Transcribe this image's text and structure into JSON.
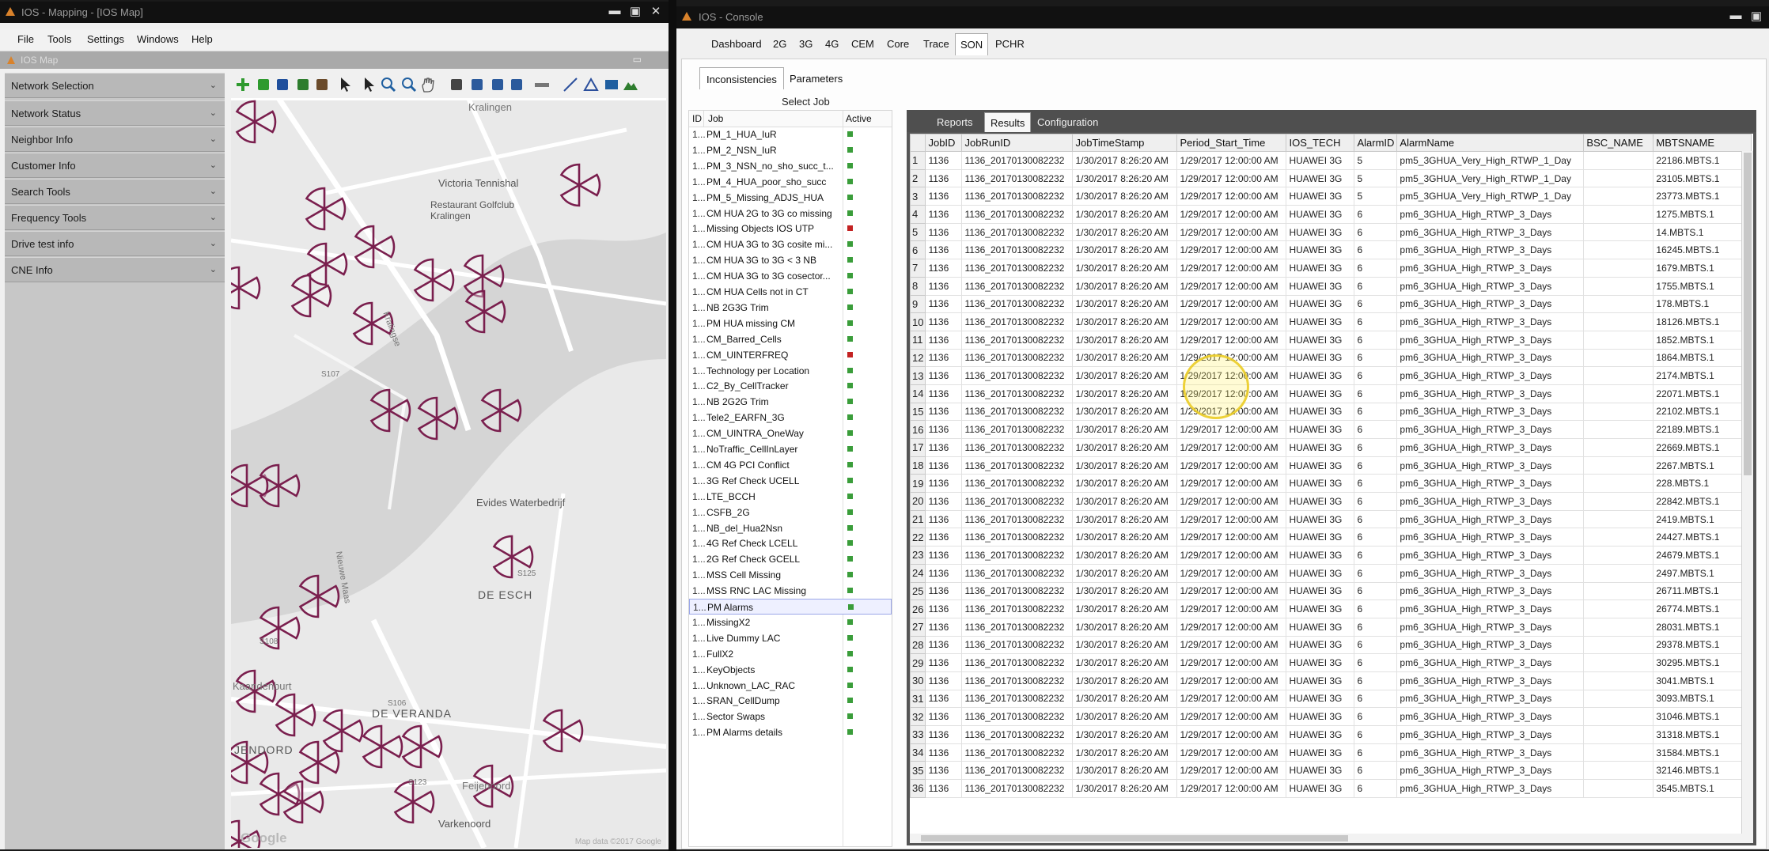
{
  "left_window": {
    "title": "IOS - Mapping - [IOS Map]",
    "menu": [
      "File",
      "Tools",
      "Settings",
      "Windows",
      "Help"
    ],
    "map_bar_title": "IOS Map",
    "panel_items": [
      "Network Selection",
      "Network Status",
      "Neighbor Info",
      "Customer Info",
      "Search Tools",
      "Frequency Tools",
      "Drive test info",
      "CNE Info"
    ],
    "toolbar_icons": [
      "add-icon",
      "add-layer-icon",
      "save-icon",
      "layers-icon",
      "theme-icon",
      "pointer-icon",
      "select-text-icon",
      "zoom-in-icon",
      "zoom-out-icon",
      "pan-hand-icon",
      "select-icon",
      "select-area-icon",
      "select-polygon-icon",
      "select-shape-icon",
      "ruler-icon",
      "line-icon",
      "polygon-icon",
      "rectangle-icon",
      "terrain-icon"
    ],
    "map": {
      "labels": [
        "Kralingen",
        "Victoria Tennishal",
        "Restaurant Golfclub Kralingen",
        "Kralingse",
        "Evides Waterbedrijf",
        "DE ESCH",
        "DE VERANDA",
        "Kaandenburt",
        "JENDORD",
        "Varkenoord",
        "Feijenoord",
        "Nieuwe Maas",
        "S107",
        "S106",
        "S123",
        "S108",
        "S125"
      ],
      "google": "Google",
      "attribution": "Map data ©2017 Google"
    }
  },
  "right_window": {
    "title": "IOS - Console",
    "tabs": [
      "Dashboard",
      "2G",
      "3G",
      "4G",
      "CEM",
      "Core",
      "Trace",
      "SON",
      "PCHR"
    ],
    "active_tab": "SON",
    "sub_tabs": [
      "Inconsistencies",
      "Parameters"
    ],
    "select_job_label": "Select Job",
    "job_list": {
      "headers": {
        "id": "ID",
        "job": "Job",
        "active": "Active"
      },
      "selected": "PM Alarms",
      "jobs": [
        {
          "id": "1...",
          "name": "PM_1_HUA_IuR",
          "status": "green"
        },
        {
          "id": "1...",
          "name": "PM_2_NSN_IuR",
          "status": "green"
        },
        {
          "id": "1...",
          "name": "PM_3_NSN_no_sho_succ_t...",
          "status": "green"
        },
        {
          "id": "1...",
          "name": "PM_4_HUA_poor_sho_succ",
          "status": "green"
        },
        {
          "id": "1...",
          "name": "PM_5_Missing_ADJS_HUA",
          "status": "green"
        },
        {
          "id": "1...",
          "name": "CM HUA 2G to 3G co missing",
          "status": "green"
        },
        {
          "id": "1...",
          "name": "Missing Objects IOS UTP",
          "status": "red"
        },
        {
          "id": "1...",
          "name": "CM HUA 3G to 3G cosite mi...",
          "status": "green"
        },
        {
          "id": "1...",
          "name": "CM HUA 3G to 3G < 3 NB",
          "status": "green"
        },
        {
          "id": "1...",
          "name": "CM HUA 3G to 3G cosector...",
          "status": "green"
        },
        {
          "id": "1...",
          "name": "CM HUA Cells not in CT",
          "status": "green"
        },
        {
          "id": "1...",
          "name": "NB 2G3G Trim",
          "status": "green"
        },
        {
          "id": "1...",
          "name": "PM HUA missing CM",
          "status": "green"
        },
        {
          "id": "1...",
          "name": "CM_Barred_Cells",
          "status": "green"
        },
        {
          "id": "1...",
          "name": "CM_UINTERFREQ",
          "status": "red"
        },
        {
          "id": "1...",
          "name": "Technology per Location",
          "status": "green"
        },
        {
          "id": "1...",
          "name": "C2_By_CellTracker",
          "status": "green"
        },
        {
          "id": "1...",
          "name": "NB 2G2G Trim",
          "status": "green"
        },
        {
          "id": "1...",
          "name": "Tele2_EARFN_3G",
          "status": "green"
        },
        {
          "id": "1...",
          "name": "CM_UINTRA_OneWay",
          "status": "green"
        },
        {
          "id": "1...",
          "name": "NoTraffic_CellInLayer",
          "status": "green"
        },
        {
          "id": "1...",
          "name": "CM 4G PCI Conflict",
          "status": "green"
        },
        {
          "id": "1...",
          "name": "3G Ref Check UCELL",
          "status": "green"
        },
        {
          "id": "1...",
          "name": "LTE_BCCH",
          "status": "green"
        },
        {
          "id": "1...",
          "name": "CSFB_2G",
          "status": "green"
        },
        {
          "id": "1...",
          "name": "NB_del_Hua2Nsn",
          "status": "green"
        },
        {
          "id": "1...",
          "name": "4G Ref Check LCELL",
          "status": "green"
        },
        {
          "id": "1...",
          "name": "2G Ref Check GCELL",
          "status": "green"
        },
        {
          "id": "1...",
          "name": "MSS Cell Missing",
          "status": "green"
        },
        {
          "id": "1...",
          "name": "MSS RNC LAC Missing",
          "status": "green"
        },
        {
          "id": "1...",
          "name": "PM Alarms",
          "status": "green"
        },
        {
          "id": "1...",
          "name": "MissingX2",
          "status": "green"
        },
        {
          "id": "1...",
          "name": "Live Dummy LAC",
          "status": "green"
        },
        {
          "id": "1...",
          "name": "FullX2",
          "status": "green"
        },
        {
          "id": "1...",
          "name": "KeyObjects",
          "status": "green"
        },
        {
          "id": "1...",
          "name": "Unknown_LAC_RAC",
          "status": "green"
        },
        {
          "id": "1...",
          "name": "SRAN_CellDump",
          "status": "green"
        },
        {
          "id": "1...",
          "name": "Sector Swaps",
          "status": "green"
        },
        {
          "id": "1...",
          "name": "PM Alarms details",
          "status": "green"
        }
      ]
    },
    "result_tabs": [
      "Reports",
      "Results",
      "Configuration"
    ],
    "active_result_tab": "Results",
    "grid": {
      "columns": [
        "",
        "JobID",
        "JobRunID",
        "JobTimeStamp",
        "Period_Start_Time",
        "IOS_TECH",
        "AlarmID",
        "AlarmName",
        "BSC_NAME",
        "MBTSNAME"
      ],
      "rows": [
        [
          "1",
          "1136",
          "1136_20170130082232",
          "1/30/2017 8:26:20 AM",
          "1/29/2017 12:00:00 AM",
          "HUAWEI 3G",
          "5",
          "pm5_3GHUA_Very_High_RTWP_1_Day",
          "",
          "22186.MBTS.1"
        ],
        [
          "2",
          "1136",
          "1136_20170130082232",
          "1/30/2017 8:26:20 AM",
          "1/29/2017 12:00:00 AM",
          "HUAWEI 3G",
          "5",
          "pm5_3GHUA_Very_High_RTWP_1_Day",
          "",
          "23105.MBTS.1"
        ],
        [
          "3",
          "1136",
          "1136_20170130082232",
          "1/30/2017 8:26:20 AM",
          "1/29/2017 12:00:00 AM",
          "HUAWEI 3G",
          "5",
          "pm5_3GHUA_Very_High_RTWP_1_Day",
          "",
          "23773.MBTS.1"
        ],
        [
          "4",
          "1136",
          "1136_20170130082232",
          "1/30/2017 8:26:20 AM",
          "1/29/2017 12:00:00 AM",
          "HUAWEI 3G",
          "6",
          "pm6_3GHUA_High_RTWP_3_Days",
          "",
          "1275.MBTS.1"
        ],
        [
          "5",
          "1136",
          "1136_20170130082232",
          "1/30/2017 8:26:20 AM",
          "1/29/2017 12:00:00 AM",
          "HUAWEI 3G",
          "6",
          "pm6_3GHUA_High_RTWP_3_Days",
          "",
          "14.MBTS.1"
        ],
        [
          "6",
          "1136",
          "1136_20170130082232",
          "1/30/2017 8:26:20 AM",
          "1/29/2017 12:00:00 AM",
          "HUAWEI 3G",
          "6",
          "pm6_3GHUA_High_RTWP_3_Days",
          "",
          "16245.MBTS.1"
        ],
        [
          "7",
          "1136",
          "1136_20170130082232",
          "1/30/2017 8:26:20 AM",
          "1/29/2017 12:00:00 AM",
          "HUAWEI 3G",
          "6",
          "pm6_3GHUA_High_RTWP_3_Days",
          "",
          "1679.MBTS.1"
        ],
        [
          "8",
          "1136",
          "1136_20170130082232",
          "1/30/2017 8:26:20 AM",
          "1/29/2017 12:00:00 AM",
          "HUAWEI 3G",
          "6",
          "pm6_3GHUA_High_RTWP_3_Days",
          "",
          "1755.MBTS.1"
        ],
        [
          "9",
          "1136",
          "1136_20170130082232",
          "1/30/2017 8:26:20 AM",
          "1/29/2017 12:00:00 AM",
          "HUAWEI 3G",
          "6",
          "pm6_3GHUA_High_RTWP_3_Days",
          "",
          "178.MBTS.1"
        ],
        [
          "10",
          "1136",
          "1136_20170130082232",
          "1/30/2017 8:26:20 AM",
          "1/29/2017 12:00:00 AM",
          "HUAWEI 3G",
          "6",
          "pm6_3GHUA_High_RTWP_3_Days",
          "",
          "18126.MBTS.1"
        ],
        [
          "11",
          "1136",
          "1136_20170130082232",
          "1/30/2017 8:26:20 AM",
          "1/29/2017 12:00:00 AM",
          "HUAWEI 3G",
          "6",
          "pm6_3GHUA_High_RTWP_3_Days",
          "",
          "1852.MBTS.1"
        ],
        [
          "12",
          "1136",
          "1136_20170130082232",
          "1/30/2017 8:26:20 AM",
          "1/29/2017 12:00:00 AM",
          "HUAWEI 3G",
          "6",
          "pm6_3GHUA_High_RTWP_3_Days",
          "",
          "1864.MBTS.1"
        ],
        [
          "13",
          "1136",
          "1136_20170130082232",
          "1/30/2017 8:26:20 AM",
          "1/29/2017 12:00:00 AM",
          "HUAWEI 3G",
          "6",
          "pm6_3GHUA_High_RTWP_3_Days",
          "",
          "2174.MBTS.1"
        ],
        [
          "14",
          "1136",
          "1136_20170130082232",
          "1/30/2017 8:26:20 AM",
          "1/29/2017 12:00:00 AM",
          "HUAWEI 3G",
          "6",
          "pm6_3GHUA_High_RTWP_3_Days",
          "",
          "22071.MBTS.1"
        ],
        [
          "15",
          "1136",
          "1136_20170130082232",
          "1/30/2017 8:26:20 AM",
          "1/29/2017 12:00:00 AM",
          "HUAWEI 3G",
          "6",
          "pm6_3GHUA_High_RTWP_3_Days",
          "",
          "22102.MBTS.1"
        ],
        [
          "16",
          "1136",
          "1136_20170130082232",
          "1/30/2017 8:26:20 AM",
          "1/29/2017 12:00:00 AM",
          "HUAWEI 3G",
          "6",
          "pm6_3GHUA_High_RTWP_3_Days",
          "",
          "22189.MBTS.1"
        ],
        [
          "17",
          "1136",
          "1136_20170130082232",
          "1/30/2017 8:26:20 AM",
          "1/29/2017 12:00:00 AM",
          "HUAWEI 3G",
          "6",
          "pm6_3GHUA_High_RTWP_3_Days",
          "",
          "22669.MBTS.1"
        ],
        [
          "18",
          "1136",
          "1136_20170130082232",
          "1/30/2017 8:26:20 AM",
          "1/29/2017 12:00:00 AM",
          "HUAWEI 3G",
          "6",
          "pm6_3GHUA_High_RTWP_3_Days",
          "",
          "2267.MBTS.1"
        ],
        [
          "19",
          "1136",
          "1136_20170130082232",
          "1/30/2017 8:26:20 AM",
          "1/29/2017 12:00:00 AM",
          "HUAWEI 3G",
          "6",
          "pm6_3GHUA_High_RTWP_3_Days",
          "",
          "228.MBTS.1"
        ],
        [
          "20",
          "1136",
          "1136_20170130082232",
          "1/30/2017 8:26:20 AM",
          "1/29/2017 12:00:00 AM",
          "HUAWEI 3G",
          "6",
          "pm6_3GHUA_High_RTWP_3_Days",
          "",
          "22842.MBTS.1"
        ],
        [
          "21",
          "1136",
          "1136_20170130082232",
          "1/30/2017 8:26:20 AM",
          "1/29/2017 12:00:00 AM",
          "HUAWEI 3G",
          "6",
          "pm6_3GHUA_High_RTWP_3_Days",
          "",
          "2419.MBTS.1"
        ],
        [
          "22",
          "1136",
          "1136_20170130082232",
          "1/30/2017 8:26:20 AM",
          "1/29/2017 12:00:00 AM",
          "HUAWEI 3G",
          "6",
          "pm6_3GHUA_High_RTWP_3_Days",
          "",
          "24427.MBTS.1"
        ],
        [
          "23",
          "1136",
          "1136_20170130082232",
          "1/30/2017 8:26:20 AM",
          "1/29/2017 12:00:00 AM",
          "HUAWEI 3G",
          "6",
          "pm6_3GHUA_High_RTWP_3_Days",
          "",
          "24679.MBTS.1"
        ],
        [
          "24",
          "1136",
          "1136_20170130082232",
          "1/30/2017 8:26:20 AM",
          "1/29/2017 12:00:00 AM",
          "HUAWEI 3G",
          "6",
          "pm6_3GHUA_High_RTWP_3_Days",
          "",
          "2497.MBTS.1"
        ],
        [
          "25",
          "1136",
          "1136_20170130082232",
          "1/30/2017 8:26:20 AM",
          "1/29/2017 12:00:00 AM",
          "HUAWEI 3G",
          "6",
          "pm6_3GHUA_High_RTWP_3_Days",
          "",
          "26711.MBTS.1"
        ],
        [
          "26",
          "1136",
          "1136_20170130082232",
          "1/30/2017 8:26:20 AM",
          "1/29/2017 12:00:00 AM",
          "HUAWEI 3G",
          "6",
          "pm6_3GHUA_High_RTWP_3_Days",
          "",
          "26774.MBTS.1"
        ],
        [
          "27",
          "1136",
          "1136_20170130082232",
          "1/30/2017 8:26:20 AM",
          "1/29/2017 12:00:00 AM",
          "HUAWEI 3G",
          "6",
          "pm6_3GHUA_High_RTWP_3_Days",
          "",
          "28031.MBTS.1"
        ],
        [
          "28",
          "1136",
          "1136_20170130082232",
          "1/30/2017 8:26:20 AM",
          "1/29/2017 12:00:00 AM",
          "HUAWEI 3G",
          "6",
          "pm6_3GHUA_High_RTWP_3_Days",
          "",
          "29378.MBTS.1"
        ],
        [
          "29",
          "1136",
          "1136_20170130082232",
          "1/30/2017 8:26:20 AM",
          "1/29/2017 12:00:00 AM",
          "HUAWEI 3G",
          "6",
          "pm6_3GHUA_High_RTWP_3_Days",
          "",
          "30295.MBTS.1"
        ],
        [
          "30",
          "1136",
          "1136_20170130082232",
          "1/30/2017 8:26:20 AM",
          "1/29/2017 12:00:00 AM",
          "HUAWEI 3G",
          "6",
          "pm6_3GHUA_High_RTWP_3_Days",
          "",
          "3041.MBTS.1"
        ],
        [
          "31",
          "1136",
          "1136_20170130082232",
          "1/30/2017 8:26:20 AM",
          "1/29/2017 12:00:00 AM",
          "HUAWEI 3G",
          "6",
          "pm6_3GHUA_High_RTWP_3_Days",
          "",
          "3093.MBTS.1"
        ],
        [
          "32",
          "1136",
          "1136_20170130082232",
          "1/30/2017 8:26:20 AM",
          "1/29/2017 12:00:00 AM",
          "HUAWEI 3G",
          "6",
          "pm6_3GHUA_High_RTWP_3_Days",
          "",
          "31046.MBTS.1"
        ],
        [
          "33",
          "1136",
          "1136_20170130082232",
          "1/30/2017 8:26:20 AM",
          "1/29/2017 12:00:00 AM",
          "HUAWEI 3G",
          "6",
          "pm6_3GHUA_High_RTWP_3_Days",
          "",
          "31318.MBTS.1"
        ],
        [
          "34",
          "1136",
          "1136_20170130082232",
          "1/30/2017 8:26:20 AM",
          "1/29/2017 12:00:00 AM",
          "HUAWEI 3G",
          "6",
          "pm6_3GHUA_High_RTWP_3_Days",
          "",
          "31584.MBTS.1"
        ],
        [
          "35",
          "1136",
          "1136_20170130082232",
          "1/30/2017 8:26:20 AM",
          "1/29/2017 12:00:00 AM",
          "HUAWEI 3G",
          "6",
          "pm6_3GHUA_High_RTWP_3_Days",
          "",
          "32146.MBTS.1"
        ],
        [
          "36",
          "1136",
          "1136_20170130082232",
          "1/30/2017 8:26:20 AM",
          "1/29/2017 12:00:00 AM",
          "HUAWEI 3G",
          "6",
          "pm6_3GHUA_High_RTWP_3_Days",
          "",
          "3545.MBTS.1"
        ]
      ]
    }
  },
  "colors": {
    "sector": "#7a1f4e",
    "active_green": "#3a9d3a",
    "inactive_red": "#c32222",
    "cursor_highlight": "#ebcd28"
  }
}
